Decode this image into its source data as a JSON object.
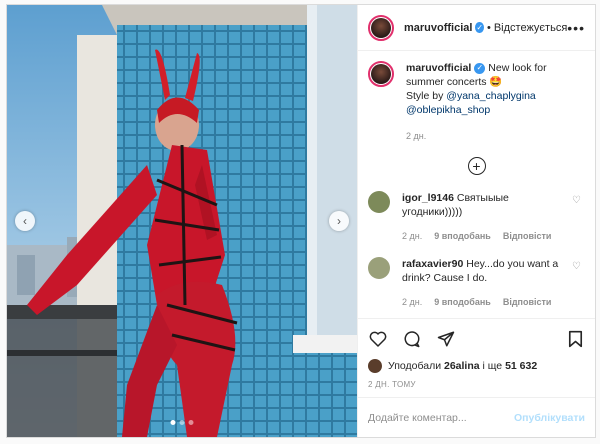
{
  "header": {
    "username": "maruvofficial",
    "separator": "•",
    "follow_label": "Відстежується",
    "more_label": "•••"
  },
  "caption": {
    "username": "maruvofficial",
    "text": "New look for summer concerts 🤩",
    "style_by": "Style by",
    "mention1": "@yana_chaplygina",
    "mention2": "@oblepikha_shop",
    "time": "2 дн."
  },
  "comments": [
    {
      "username": "igor_l9146",
      "text": "Святыыые угодники)))))",
      "time": "2 дн.",
      "likes": "9 вподобань",
      "reply": "Відповісти",
      "avatar_color": "#7d8a5a"
    },
    {
      "username": "rafaxavier90",
      "text": "Hey...do you want a drink? Cause I do.",
      "time": "2 дн.",
      "likes": "9 вподобань",
      "reply": "Відповісти",
      "avatar_color": "#9aa07a"
    }
  ],
  "likes": {
    "prefix": "Уподобали",
    "user": "26alina",
    "suffix": "і ще",
    "count": "51 632"
  },
  "post_time": "2 ДН. ТОМУ",
  "add_comment": {
    "placeholder": "Додайте коментар...",
    "publish_label": "Опублікувати"
  },
  "carousel": {
    "slide_count": 3,
    "active_index": 0
  },
  "colors": {
    "link": "#00376b",
    "verified": "#3897f0",
    "publish_disabled": "#b2dffc",
    "story_ring": "#e1306c"
  }
}
